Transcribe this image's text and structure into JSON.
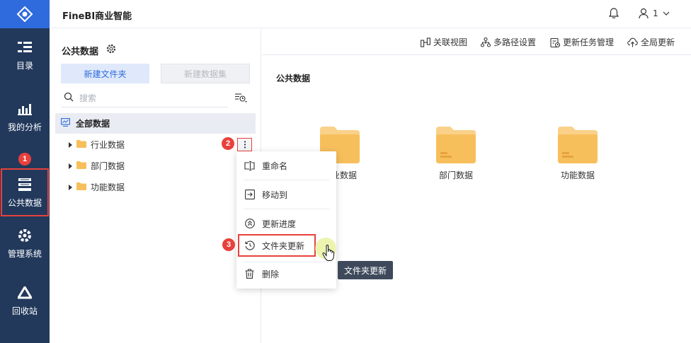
{
  "header": {
    "app_title": "FineBI商业智能",
    "user_name": "1"
  },
  "nav": {
    "items": [
      {
        "label": "目录"
      },
      {
        "label": "我的分析"
      },
      {
        "label": "公共数据"
      },
      {
        "label": "管理系统"
      },
      {
        "label": "回收站"
      }
    ]
  },
  "panel": {
    "title": "公共数据",
    "new_folder": "新建文件夹",
    "new_dataset": "新建数据集",
    "search_placeholder": "搜索",
    "tree_root": "全部数据",
    "tree_nodes": [
      {
        "label": "行业数据"
      },
      {
        "label": "部门数据"
      },
      {
        "label": "功能数据"
      }
    ]
  },
  "toolbar": {
    "items": [
      {
        "label": "关联视图"
      },
      {
        "label": "多路径设置"
      },
      {
        "label": "更新任务管理"
      },
      {
        "label": "全局更新"
      }
    ]
  },
  "main": {
    "title": "公共数据",
    "cards": [
      {
        "label": "行业数据"
      },
      {
        "label": "部门数据"
      },
      {
        "label": "功能数据"
      }
    ]
  },
  "context_menu": {
    "items": [
      {
        "label": "重命名"
      },
      {
        "label": "移动到"
      },
      {
        "label": "更新进度"
      },
      {
        "label": "文件夹更新"
      },
      {
        "label": "删除"
      }
    ]
  },
  "tooltip": "文件夹更新",
  "badges": [
    "1",
    "2",
    "3"
  ],
  "colors": {
    "nav_bg": "#22395c",
    "accent": "#2f6bdc",
    "highlight": "#e8413c",
    "folder": "#f7bf5c"
  }
}
